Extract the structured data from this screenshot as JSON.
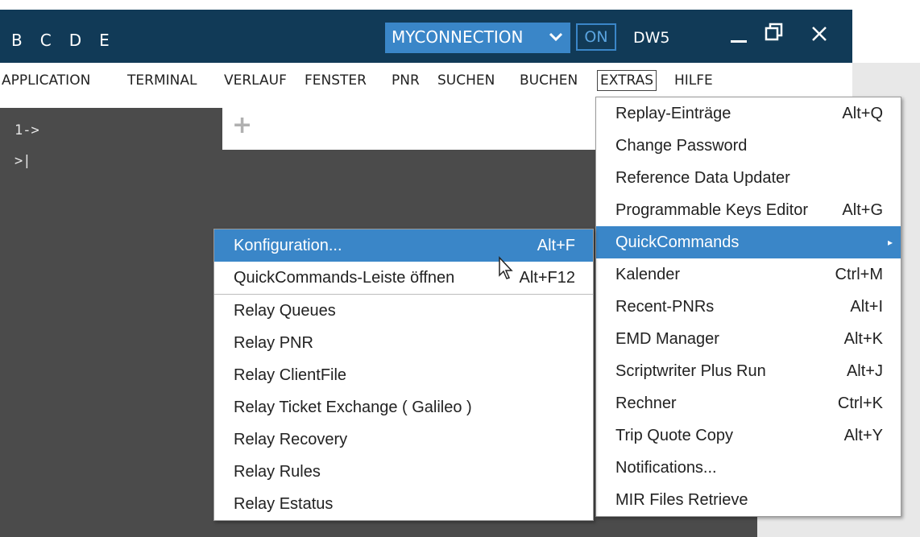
{
  "window": {
    "tab_letters": [
      "B",
      "C",
      "D",
      "E"
    ],
    "connection": "MYCONNECTION",
    "toggle": "ON",
    "workspace": "DW5",
    "minimize": "_",
    "restore": "□",
    "close": "✕"
  },
  "menubar": [
    "APPLICATION",
    "TERMINAL",
    "VERLAUF",
    "FENSTER",
    "PNR",
    "SUCHEN",
    "BUCHEN",
    "EXTRAS",
    "HILFE"
  ],
  "terminal": {
    "prompt": "1->",
    "cursor": ">|"
  },
  "new_tab": "+",
  "extras_menu": [
    {
      "label": "Replay-Einträge",
      "shortcut": "Alt+Q"
    },
    {
      "label": "Change Password",
      "shortcut": ""
    },
    {
      "label": "Reference Data Updater",
      "shortcut": ""
    },
    {
      "label": "Programmable Keys Editor",
      "shortcut": "Alt+G"
    },
    {
      "label": "QuickCommands",
      "shortcut": "",
      "submenu": "▸"
    },
    {
      "label": "Kalender",
      "shortcut": "Ctrl+M"
    },
    {
      "label": "Recent-PNRs",
      "shortcut": "Alt+I"
    },
    {
      "label": "EMD Manager",
      "shortcut": "Alt+K"
    },
    {
      "label": "Scriptwriter Plus Run",
      "shortcut": "Alt+J"
    },
    {
      "label": "Rechner",
      "shortcut": "Ctrl+K"
    },
    {
      "label": "Trip Quote Copy",
      "shortcut": "Alt+Y"
    },
    {
      "label": "Notifications...",
      "shortcut": ""
    },
    {
      "label": "MIR Files Retrieve",
      "shortcut": ""
    }
  ],
  "quickcommands_menu": {
    "top": [
      {
        "label": "Konfiguration...",
        "shortcut": "Alt+F"
      },
      {
        "label": "QuickCommands-Leiste öffnen",
        "shortcut": "Alt+F12"
      }
    ],
    "relay": [
      "Relay Queues",
      "Relay PNR",
      "Relay ClientFile",
      "Relay Ticket Exchange ( Galileo )",
      "Relay Recovery",
      "Relay Rules",
      "Relay Estatus"
    ]
  },
  "colors": {
    "titlebar": "#113a57",
    "accent": "#3a86c8",
    "terminal": "#4b4b4b"
  }
}
